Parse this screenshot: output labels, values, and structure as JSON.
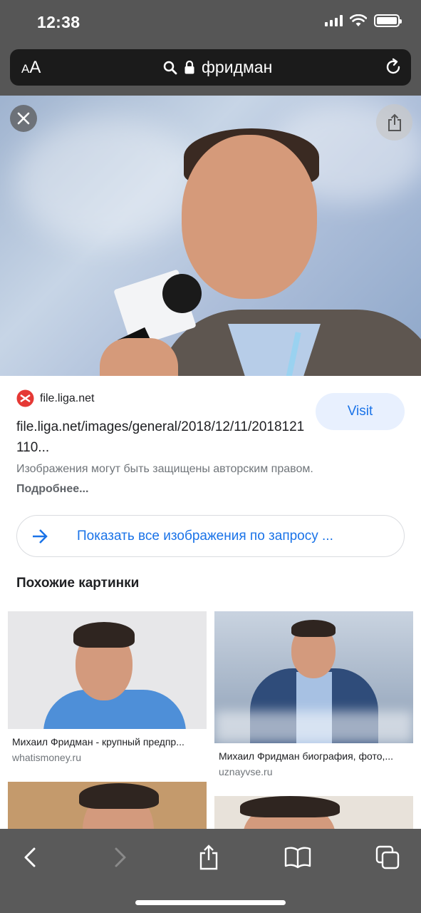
{
  "status_bar": {
    "time": "12:38"
  },
  "address_bar": {
    "text_size_label_small": "A",
    "text_size_label_large": "A",
    "query": "фридман"
  },
  "result": {
    "source_name": "file.liga.net",
    "visit_label": "Visit",
    "image_url": "file.liga.net/images/general/2018/12/11/2018121110...",
    "copyright_text": "Изображения могут быть защищены авторским правом.",
    "more_link": "Подробнее...",
    "show_all_label": "Показать все изображения по запросу ..."
  },
  "similar": {
    "title": "Похожие картинки",
    "items": [
      {
        "caption": "Михаил Фридман - крупный предпр...",
        "domain": "whatismoney.ru"
      },
      {
        "caption": "Михаил Фридман биография, фото,...",
        "domain": "uznayvse.ru"
      },
      {
        "caption": "",
        "domain": ""
      },
      {
        "caption": "",
        "domain": ""
      }
    ]
  },
  "colors": {
    "link_blue": "#1a73e8",
    "visit_bg": "#e8f0fe",
    "chrome_dark": "#565656"
  }
}
